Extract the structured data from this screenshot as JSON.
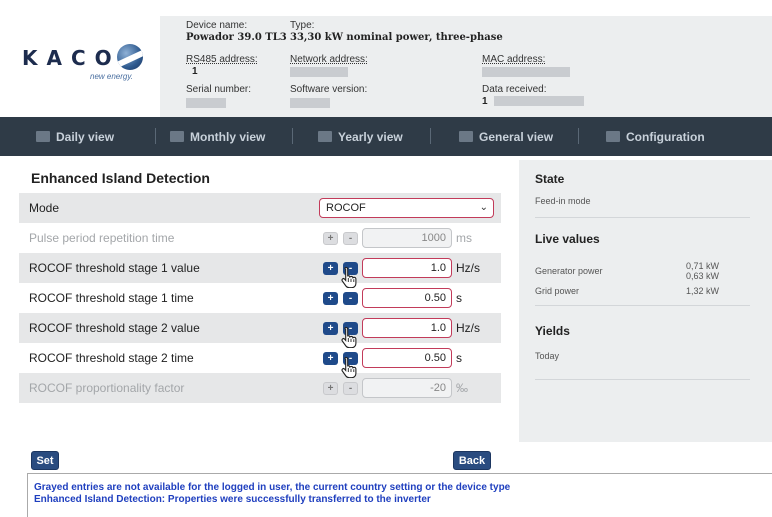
{
  "brand": {
    "name": "KACO",
    "tagline": "new energy."
  },
  "device": {
    "name_label": "Device name:",
    "name_value": "Powador 39.0 TL3",
    "type_label": "Type:",
    "type_value": "33,30 kW nominal power, three-phase",
    "rs485_label": "RS485 address:",
    "rs485_value": "1",
    "network_label": "Network address:",
    "mac_label": "MAC address:",
    "serial_label": "Serial number:",
    "software_label": "Software version:",
    "data_received_label": "Data received:",
    "data_received_value": "1"
  },
  "nav": {
    "items": [
      {
        "label": "Daily view"
      },
      {
        "label": "Monthly view"
      },
      {
        "label": "Yearly view"
      },
      {
        "label": "General view"
      },
      {
        "label": "Configuration"
      }
    ]
  },
  "main": {
    "title": "Enhanced Island Detection",
    "mode": {
      "label": "Mode",
      "value": "ROCOF"
    },
    "rows": [
      {
        "label": "Pulse period repetition time",
        "value": "1000",
        "unit": "ms",
        "enabled": false
      },
      {
        "label": "ROCOF threshold stage 1 value",
        "value": "1.0",
        "unit": "Hz/s",
        "enabled": true
      },
      {
        "label": "ROCOF threshold stage 1 time",
        "value": "0.50",
        "unit": "s",
        "enabled": true
      },
      {
        "label": "ROCOF threshold stage 2 value",
        "value": "1.0",
        "unit": "Hz/s",
        "enabled": true
      },
      {
        "label": "ROCOF threshold stage 2 time",
        "value": "0.50",
        "unit": "s",
        "enabled": true
      },
      {
        "label": "ROCOF proportionality factor",
        "value": "-20",
        "unit": "‰",
        "enabled": false
      }
    ],
    "plus_label": "+",
    "minus_label": "-"
  },
  "sidebar": {
    "state_title": "State",
    "state_value": "Feed-in mode",
    "live_title": "Live values",
    "generator_label": "Generator power",
    "generator_value_1": "0,71 kW",
    "generator_value_2": "0,63 kW",
    "grid_label": "Grid power",
    "grid_value": "1,32 kW",
    "yields_title": "Yields",
    "today_label": "Today"
  },
  "actions": {
    "set_label": "Set",
    "back_label": "Back"
  },
  "messages": {
    "line1": "Grayed entries are not available for the logged in user, the current country setting or the device type",
    "line2": "Enhanced Island Detection: Properties were successfully transferred to the inverter"
  },
  "colors": {
    "nav_bg": "#2f3b47",
    "accent_border": "#c23b5a",
    "button_blue": "#2a4c80",
    "message_blue": "#1f3fbf"
  }
}
